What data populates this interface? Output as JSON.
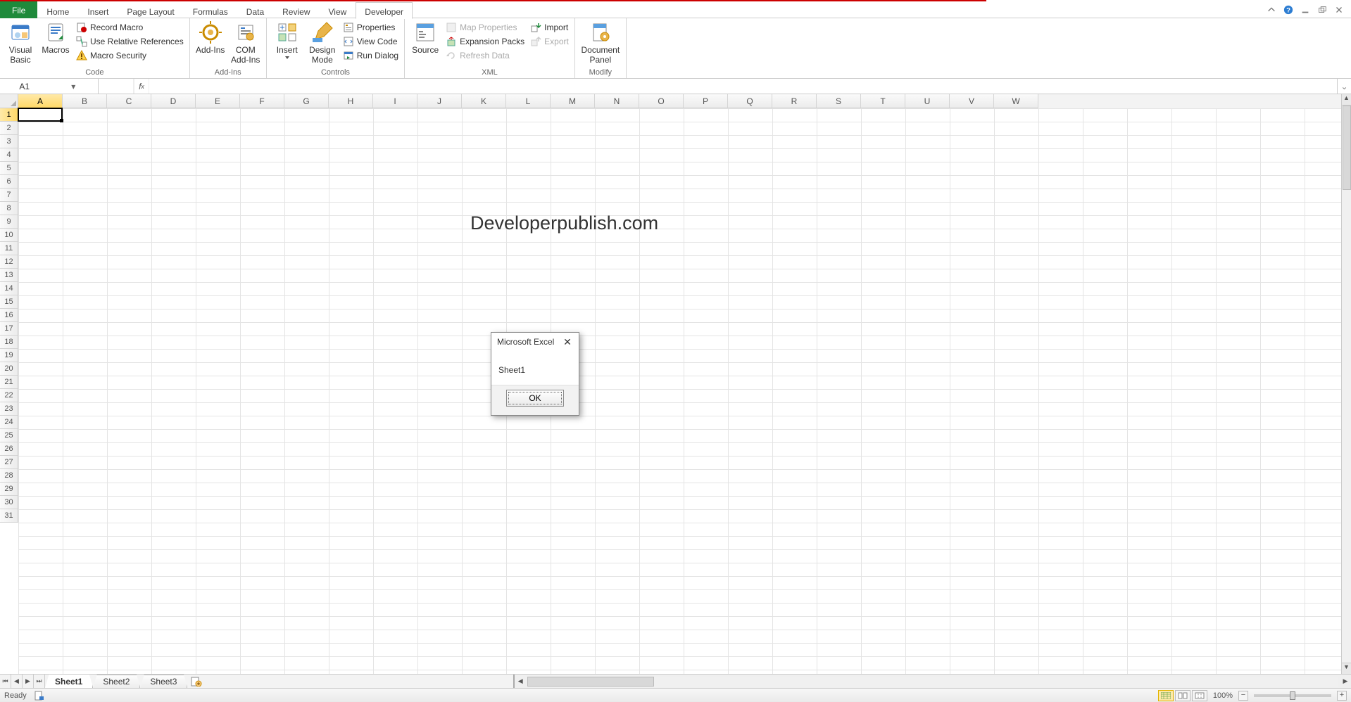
{
  "tabs": {
    "file": "File",
    "items": [
      "Home",
      "Insert",
      "Page Layout",
      "Formulas",
      "Data",
      "Review",
      "View",
      "Developer"
    ],
    "active": "Developer"
  },
  "ribbon": {
    "code": {
      "label": "Code",
      "visual_basic": "Visual Basic",
      "macros": "Macros",
      "record_macro": "Record Macro",
      "use_relative": "Use Relative References",
      "macro_security": "Macro Security"
    },
    "addins": {
      "label": "Add-Ins",
      "addins": "Add-Ins",
      "com_addins": "COM Add-Ins"
    },
    "controls": {
      "label": "Controls",
      "insert": "Insert",
      "design_mode": "Design Mode",
      "properties": "Properties",
      "view_code": "View Code",
      "run_dialog": "Run Dialog"
    },
    "xml": {
      "label": "XML",
      "source": "Source",
      "map_properties": "Map Properties",
      "expansion_packs": "Expansion Packs",
      "refresh_data": "Refresh Data",
      "import": "Import",
      "export": "Export"
    },
    "modify": {
      "label": "Modify",
      "document_panel": "Document Panel"
    }
  },
  "namebox": {
    "value": "A1"
  },
  "formula": {
    "value": ""
  },
  "columns": [
    "A",
    "B",
    "C",
    "D",
    "E",
    "F",
    "G",
    "H",
    "I",
    "J",
    "K",
    "L",
    "M",
    "N",
    "O",
    "P",
    "Q",
    "R",
    "S",
    "T",
    "U",
    "V",
    "W"
  ],
  "rows_visible": 31,
  "active": {
    "col": "A",
    "row": 1
  },
  "watermark": "Developerpublish.com",
  "sheets": {
    "items": [
      "Sheet1",
      "Sheet2",
      "Sheet3"
    ],
    "active": "Sheet1"
  },
  "status": {
    "ready": "Ready",
    "zoom_pct": "100%"
  },
  "dialog": {
    "title": "Microsoft Excel",
    "message": "Sheet1",
    "ok": "OK"
  }
}
